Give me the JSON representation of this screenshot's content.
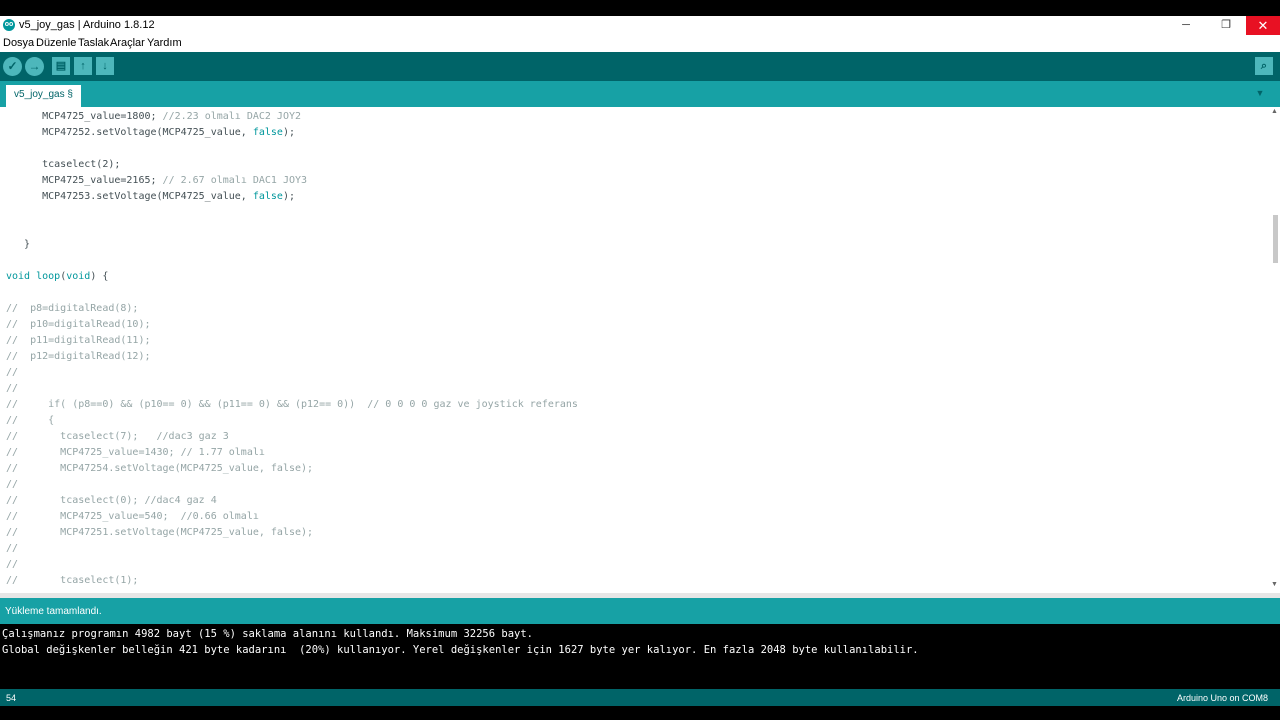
{
  "window": {
    "title": "v5_joy_gas | Arduino 1.8.12",
    "icon_text": "oo",
    "minimize_glyph": "─",
    "maximize_glyph": "❐",
    "close_glyph": "✕"
  },
  "menu": [
    "Dosya",
    "Düzenle",
    "Taslak",
    "Araçlar",
    "Yardım"
  ],
  "toolbar": {
    "verify_icon": "✓",
    "upload_icon": "→",
    "new_icon": "▤",
    "open_icon": "↑",
    "save_icon": "↓",
    "serial_monitor_icon": "⌕"
  },
  "tabs": {
    "active": "v5_joy_gas §",
    "menu_glyph": "▼"
  },
  "code_lines": [
    [
      {
        "t": "      MCP4725_value=1800; "
      },
      {
        "t": "//2.23 olmalı DAC2 JOY2",
        "c": "cm"
      }
    ],
    [
      {
        "t": "      MCP47252.setVoltage(MCP4725_value, "
      },
      {
        "t": "false",
        "c": "kw"
      },
      {
        "t": ");"
      }
    ],
    [],
    [
      {
        "t": "      tcaselect(2);"
      }
    ],
    [
      {
        "t": "      MCP4725_value=2165; "
      },
      {
        "t": "// 2.67 olmalı DAC1 JOY3",
        "c": "cm"
      }
    ],
    [
      {
        "t": "      MCP47253.setVoltage(MCP4725_value, "
      },
      {
        "t": "false",
        "c": "kw"
      },
      {
        "t": ");"
      }
    ],
    [],
    [],
    [
      {
        "t": "   }"
      }
    ],
    [],
    [
      {
        "t": "void",
        "c": "kw"
      },
      {
        "t": " "
      },
      {
        "t": "loop",
        "c": "kw"
      },
      {
        "t": "("
      },
      {
        "t": "void",
        "c": "kw"
      },
      {
        "t": ") {"
      }
    ],
    [],
    [
      {
        "t": "//  p8=digitalRead(8);",
        "c": "cm"
      }
    ],
    [
      {
        "t": "//  p10=digitalRead(10);",
        "c": "cm"
      }
    ],
    [
      {
        "t": "//  p11=digitalRead(11);",
        "c": "cm"
      }
    ],
    [
      {
        "t": "//  p12=digitalRead(12);",
        "c": "cm"
      }
    ],
    [
      {
        "t": "//",
        "c": "cm"
      }
    ],
    [
      {
        "t": "//",
        "c": "cm"
      }
    ],
    [
      {
        "t": "//     if( (p8==0) && (p10== 0) && (p11== 0) && (p12== 0))  // 0 0 0 0 gaz ve joystick referans",
        "c": "cm"
      }
    ],
    [
      {
        "t": "//     {",
        "c": "cm"
      }
    ],
    [
      {
        "t": "//       tcaselect(7);   //dac3 gaz 3",
        "c": "cm"
      }
    ],
    [
      {
        "t": "//       MCP4725_value=1430; // 1.77 olmalı",
        "c": "cm"
      }
    ],
    [
      {
        "t": "//       MCP47254.setVoltage(MCP4725_value, false);",
        "c": "cm"
      }
    ],
    [
      {
        "t": "//",
        "c": "cm"
      }
    ],
    [
      {
        "t": "//       tcaselect(0); //dac4 gaz 4",
        "c": "cm"
      }
    ],
    [
      {
        "t": "//       MCP4725_value=540;  //0.66 olmalı",
        "c": "cm"
      }
    ],
    [
      {
        "t": "//       MCP47251.setVoltage(MCP4725_value, false);",
        "c": "cm"
      }
    ],
    [
      {
        "t": "//",
        "c": "cm"
      }
    ],
    [
      {
        "t": "//",
        "c": "cm"
      }
    ],
    [
      {
        "t": "//       tcaselect(1);",
        "c": "cm"
      }
    ]
  ],
  "status": {
    "message": "Yükleme tamamlandı."
  },
  "console": [
    "Çalışmanız programın 4982 bayt (15 %) saklama alanını kullandı. Maksimum 32256 bayt.",
    "Global değişkenler belleğin 421 byte kadarını  (20%) kullanıyor. Yerel değişkenler için 1627 byte yer kalıyor. En fazla 2048 byte kullanılabilir."
  ],
  "footer": {
    "line_number": "54",
    "board": "Arduino Uno on COM8"
  },
  "scroll": {
    "up_glyph": "▲",
    "down_glyph": "▼"
  },
  "colors": {
    "toolbar_bg": "#006468",
    "tab_bar_bg": "#17a1a5",
    "keyword": "#00979c",
    "comment": "#95a5a6",
    "close_button": "#e81123"
  }
}
